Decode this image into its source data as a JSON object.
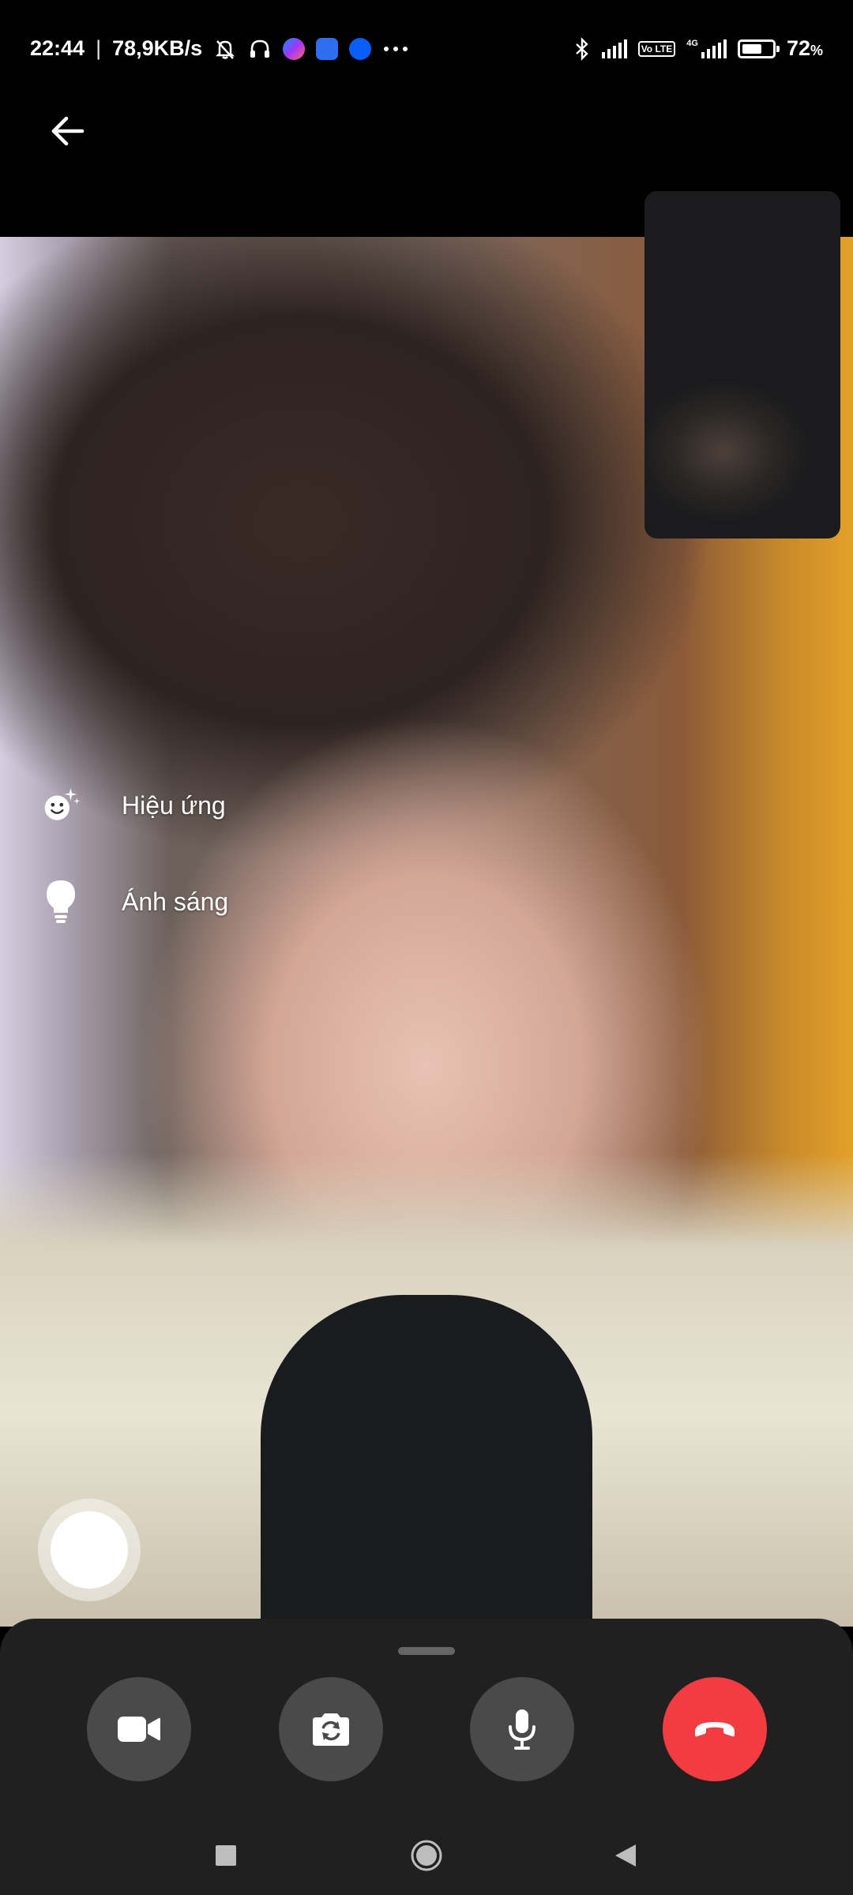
{
  "status_bar": {
    "time": "22:44",
    "net_speed": "78,9KB/s",
    "battery_percent": "72",
    "battery_unit": "%",
    "network": "4G",
    "volte_label": "Vo LTE",
    "icons": [
      "mute-bell-icon",
      "headphones-icon",
      "messenger-icon",
      "messages-icon",
      "app-icon",
      "more-dots-icon",
      "bluetooth-icon",
      "signal-icon",
      "volte-icon",
      "signal-4g-icon",
      "battery-icon"
    ],
    "battery_level": 0.72
  },
  "call": {
    "side_options": {
      "effects_label": "Hiệu ứng",
      "light_label": "Ánh sáng"
    },
    "controls": {
      "icons": [
        "video-camera-icon",
        "flip-camera-icon",
        "microphone-icon",
        "end-call-icon"
      ],
      "end_call_color": "#f33c42",
      "button_color": "#4a4a4a"
    }
  },
  "nav_bar": {
    "icons": [
      "recents-square-icon",
      "home-circle-icon",
      "back-triangle-icon"
    ]
  }
}
